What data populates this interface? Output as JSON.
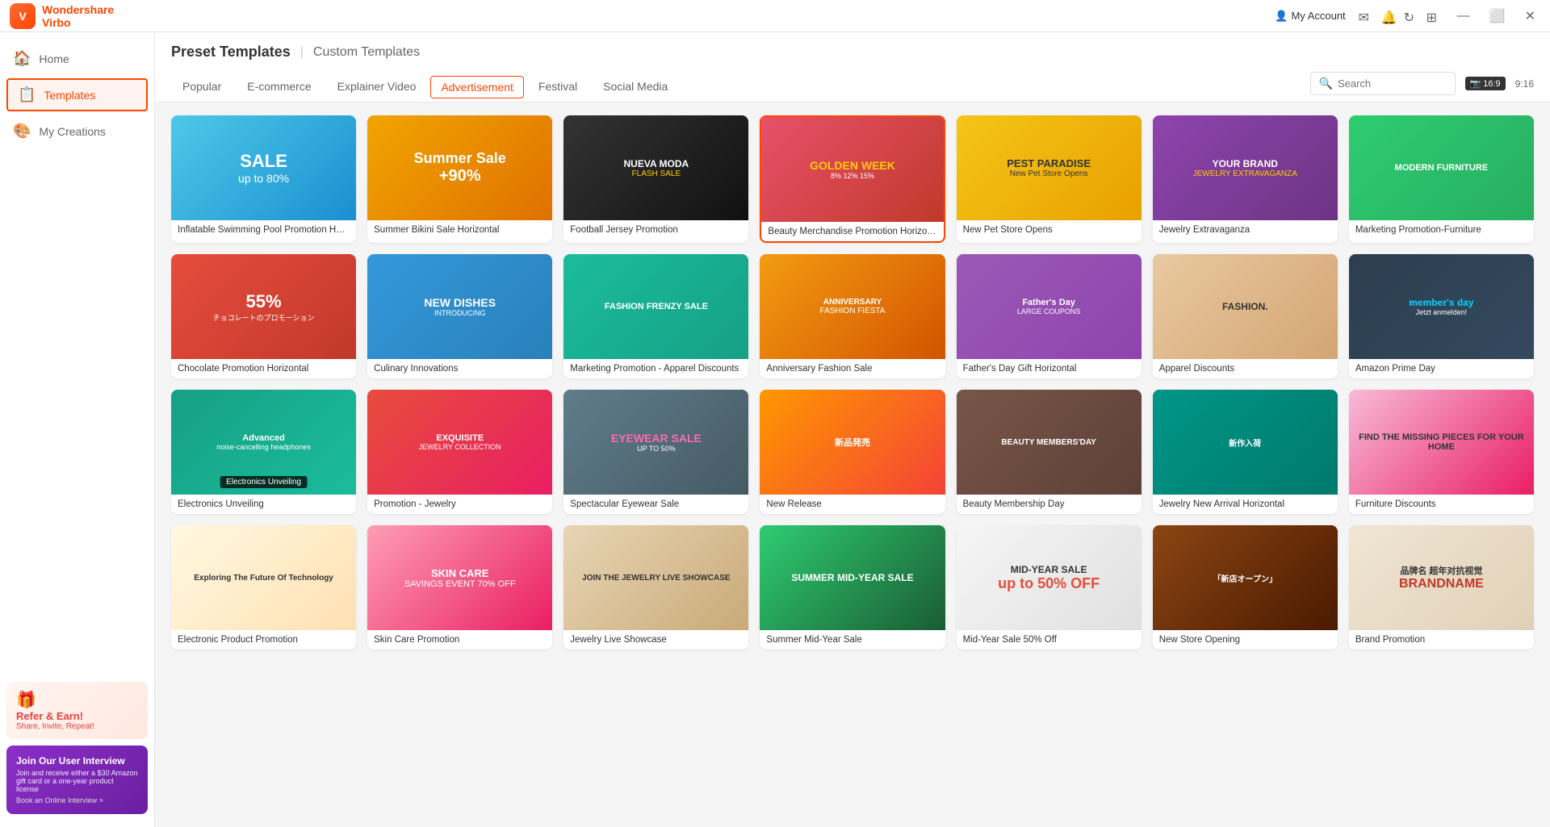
{
  "app": {
    "logo": "V",
    "name_part1": "Wondershare",
    "name_part2": "Virbo"
  },
  "titlebar": {
    "account_label": "My Account",
    "icons": [
      "message-icon",
      "bookmark-icon",
      "refresh-icon",
      "grid-icon"
    ],
    "win_controls": [
      "minimize",
      "maximize",
      "close"
    ]
  },
  "sidebar": {
    "items": [
      {
        "id": "home",
        "label": "Home",
        "icon": "🏠",
        "active": false
      },
      {
        "id": "templates",
        "label": "Templates",
        "icon": "📋",
        "active": true
      },
      {
        "id": "my-creations",
        "label": "My Creations",
        "icon": "🎨",
        "active": false
      }
    ]
  },
  "header": {
    "preset_label": "Preset Templates",
    "divider": "|",
    "custom_label": "Custom Templates",
    "tabs": [
      {
        "id": "popular",
        "label": "Popular",
        "active": false
      },
      {
        "id": "ecommerce",
        "label": "E-commerce",
        "active": false
      },
      {
        "id": "explainer",
        "label": "Explainer Video",
        "active": false
      },
      {
        "id": "advertisement",
        "label": "Advertisement",
        "active": true
      },
      {
        "id": "festival",
        "label": "Festival",
        "active": false
      },
      {
        "id": "social-media",
        "label": "Social Media",
        "active": false
      }
    ],
    "search_placeholder": "Search",
    "ratio": "16:9",
    "time": "9:16"
  },
  "templates": [
    {
      "id": 1,
      "label": "Inflatable Swimming Pool Promotion Hori...",
      "theme": "t1",
      "selected": false,
      "tooltip": null
    },
    {
      "id": 2,
      "label": "Summer Bikini Sale Horizontal",
      "theme": "t2",
      "selected": false,
      "tooltip": null
    },
    {
      "id": 3,
      "label": "Football Jersey Promotion",
      "theme": "t3",
      "selected": false,
      "tooltip": null
    },
    {
      "id": 4,
      "label": "Beauty Merchandise Promotion Horizontal",
      "theme": "t4",
      "selected": true,
      "tooltip": null
    },
    {
      "id": 5,
      "label": "New Pet Store Opens",
      "theme": "t5",
      "selected": false,
      "tooltip": null
    },
    {
      "id": 6,
      "label": "Jewelry Extravaganza",
      "theme": "t6",
      "selected": false,
      "tooltip": null
    },
    {
      "id": 7,
      "label": "Marketing Promotion-Furniture",
      "theme": "t7",
      "selected": false,
      "tooltip": null
    },
    {
      "id": 8,
      "label": "Chocolate Promotion Horizontal",
      "theme": "t8",
      "selected": false,
      "tooltip": null
    },
    {
      "id": 9,
      "label": "Culinary Innovations",
      "theme": "t9",
      "selected": false,
      "tooltip": null
    },
    {
      "id": 10,
      "label": "Marketing Promotion - Apparel Discounts",
      "theme": "t10",
      "selected": false,
      "tooltip": null
    },
    {
      "id": 11,
      "label": "Anniversary Fashion Sale",
      "theme": "t11",
      "selected": false,
      "tooltip": null
    },
    {
      "id": 12,
      "label": "Father's Day Gift Horizontal",
      "theme": "t12",
      "selected": false,
      "tooltip": null
    },
    {
      "id": 13,
      "label": "Apparel Discounts",
      "theme": "t13",
      "selected": false,
      "tooltip": null
    },
    {
      "id": 14,
      "label": "Amazon Prime Day",
      "theme": "t14",
      "selected": false,
      "tooltip": null
    },
    {
      "id": 15,
      "label": "Electronics Unveiling",
      "theme": "t15",
      "selected": false,
      "tooltip": "Electronics Unveiling"
    },
    {
      "id": 16,
      "label": "Promotion - Jewelry",
      "theme": "t16",
      "selected": false,
      "tooltip": null
    },
    {
      "id": 17,
      "label": "Spectacular Eyewear Sale",
      "theme": "t17",
      "selected": false,
      "tooltip": null
    },
    {
      "id": 18,
      "label": "New Release",
      "theme": "t18",
      "selected": false,
      "tooltip": null
    },
    {
      "id": 19,
      "label": "Beauty Membership Day",
      "theme": "t19",
      "selected": false,
      "tooltip": null
    },
    {
      "id": 20,
      "label": "Jewelry New Arrival Horizontal",
      "theme": "t20",
      "selected": false,
      "tooltip": null
    },
    {
      "id": 21,
      "label": "Furniture Discounts",
      "theme": "t21",
      "selected": false,
      "tooltip": null
    },
    {
      "id": 22,
      "label": "Electronic Product Promotion",
      "theme": "t22",
      "selected": false,
      "tooltip": null
    },
    {
      "id": 23,
      "label": "Skin Care Promotion",
      "theme": "t15",
      "selected": false,
      "tooltip": null
    },
    {
      "id": 24,
      "label": "Jewelry Live Showcase",
      "theme": "t12",
      "selected": false,
      "tooltip": null
    },
    {
      "id": 25,
      "label": "Summer Mid-Year Sale",
      "theme": "t1",
      "selected": false,
      "tooltip": null
    },
    {
      "id": 26,
      "label": "Mid-Year Sale 50% Off",
      "theme": "t9",
      "selected": false,
      "tooltip": null
    },
    {
      "id": 27,
      "label": "New Store Opening",
      "theme": "t8",
      "selected": false,
      "tooltip": null
    },
    {
      "id": 28,
      "label": "Brand Promotion",
      "theme": "t11",
      "selected": false,
      "tooltip": null
    }
  ],
  "banners": {
    "refer": {
      "icon": "🎁",
      "title": "Refer & Earn!",
      "subtitle": "Share, Invite, Repeat!"
    },
    "interview": {
      "title": "Join Our User Interview",
      "subtitle": "Join and receive either a $30 Amazon gift card or a one-year product license",
      "cta": "Book an Online Interview >"
    }
  }
}
